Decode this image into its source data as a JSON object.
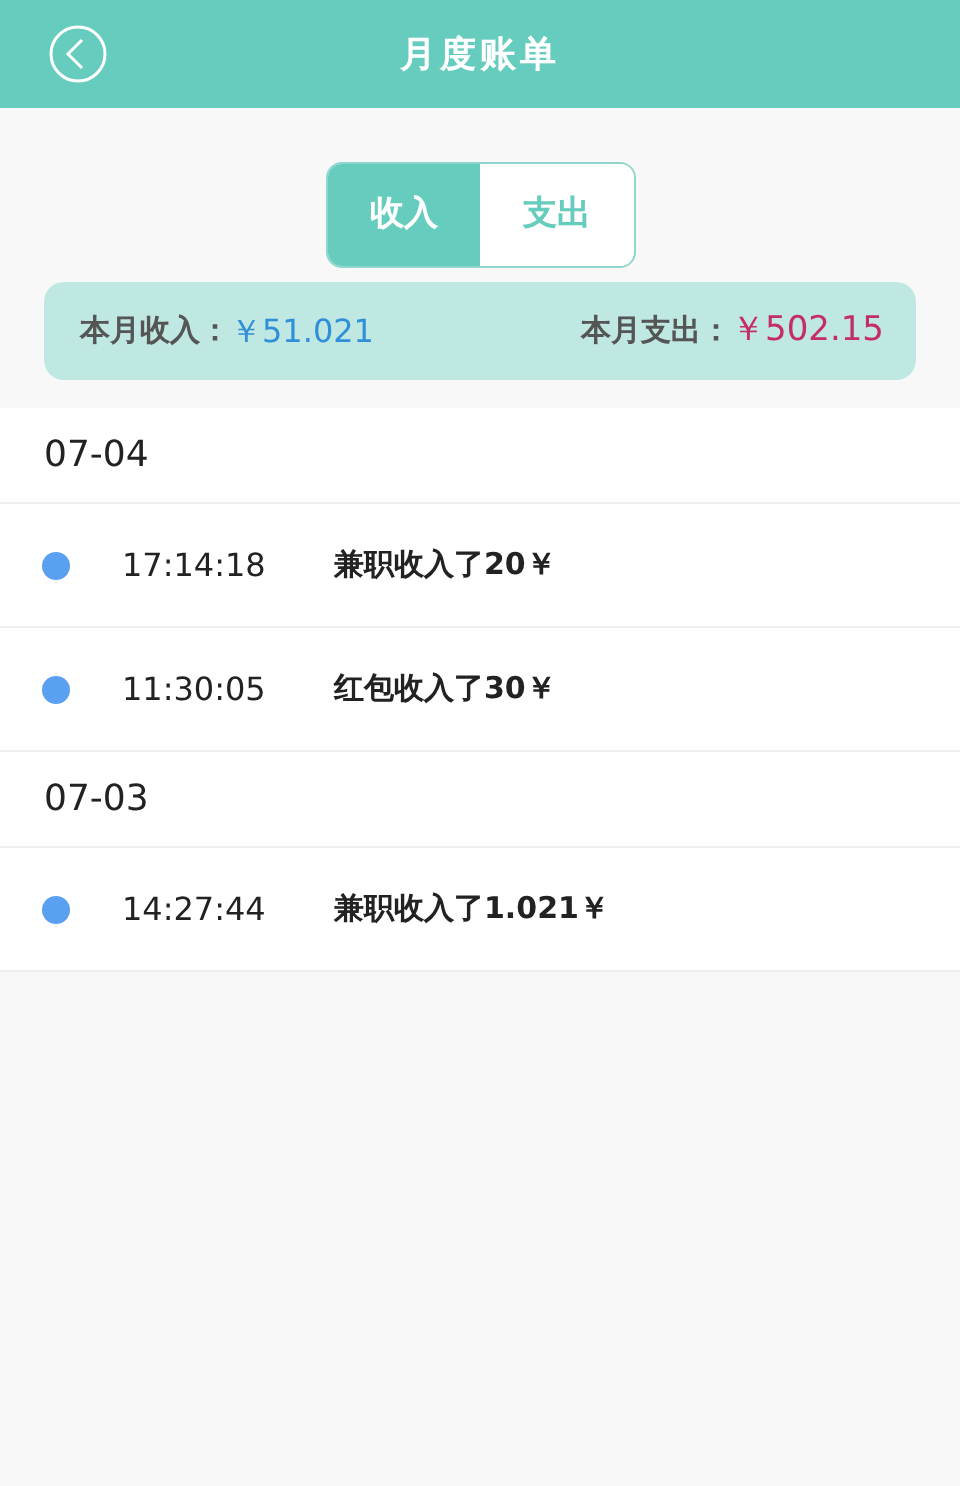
{
  "header": {
    "title": "月度账单"
  },
  "tabs": [
    {
      "label": "收入",
      "selected": true
    },
    {
      "label": "支出",
      "selected": false
    }
  ],
  "summary": {
    "income_label": "本月收入：",
    "income": "￥51.021",
    "expense_label": "本月支出：",
    "expense": "￥502.15"
  },
  "groups": [
    {
      "date": "07-04",
      "items": [
        {
          "time": "17:14:18",
          "text": "兼职收入了20￥"
        },
        {
          "time": "11:30:05",
          "text": "红包收入了30￥"
        }
      ]
    },
    {
      "date": "07-03",
      "items": [
        {
          "time": "14:27:44",
          "text": "兼职收入了1.021￥"
        }
      ]
    }
  ]
}
